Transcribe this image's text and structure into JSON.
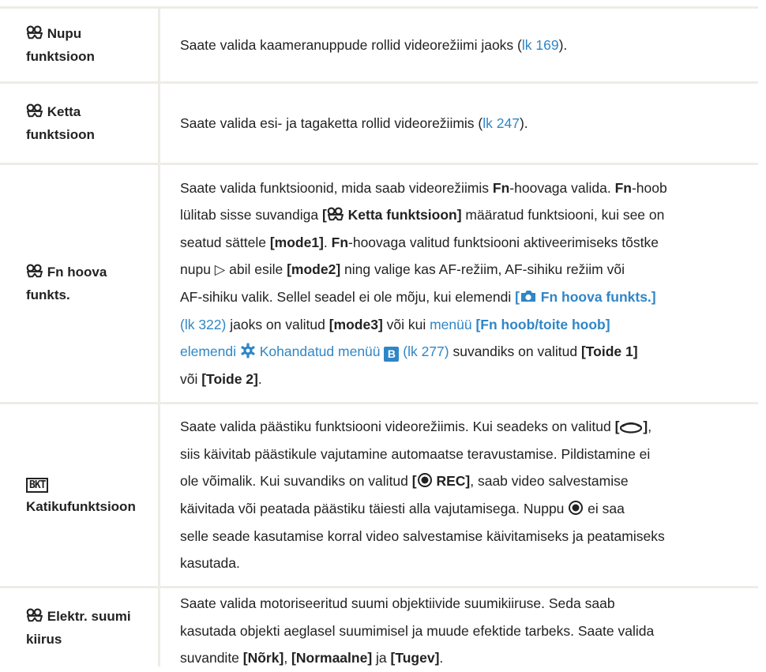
{
  "rows": [
    {
      "label_line1": "Nupu",
      "label_line2": "funktsioon",
      "desc_pre": "Saate valida kaameranuppude rollid videorežiimi jaoks (",
      "desc_link": "lk 169",
      "desc_post": ")."
    },
    {
      "label_line1": "Ketta",
      "label_line2": "funktsioon",
      "desc_pre": "Saate valida esi- ja tagaketta rollid videorežiimis (",
      "desc_link": "lk 247",
      "desc_post": ")."
    },
    {
      "label_line1": "Fn hoova",
      "label_line2": "funkts.",
      "t1": "Saate valida funktsioonid, mida saab videorežiimis ",
      "t2": "Fn",
      "t3": "-hoovaga valida. ",
      "t4": "Fn",
      "t5": "-hoob",
      "t6": "lülitab sisse suvandiga ",
      "t7": "[",
      "t8": " Ketta funktsioon]",
      "t9": " määratud funktsiooni, kui see on",
      "t10": "seatud sättele ",
      "t11": "[mode1]",
      "t12": ". ",
      "t13": "Fn",
      "t14": "-hoovaga valitud funktsiooni aktiveerimiseks tõstke",
      "t15": "nupu ",
      "t16": "▷",
      "t17": " abil esile ",
      "t18": "[mode2]",
      "t19": " ning valige kas AF-režiim, AF-sihiku režiim või",
      "t20": "AF-sihiku valik. Sellel seadel ei ole mõju, kui elemendi ",
      "t21": "[",
      "t22": " Fn hoova funkts.]",
      "t23": "(lk 322)",
      "t24": " jaoks on valitud ",
      "t25": "[mode3]",
      "t26": " või kui ",
      "t27": "menüü ",
      "t28": "[Fn hoob/toite hoob]",
      "t29": "elemendi ",
      "t30": " Kohandatud menüü ",
      "t31": "B",
      "t32": " (lk 277)",
      "t33": " suvandiks on valitud ",
      "t34": "[Toide 1]",
      "t35": "või ",
      "t36": "[Toide 2]",
      "t37": "."
    },
    {
      "label_icon_text": "BKT",
      "label_line2": "Katikufunktsioon",
      "l1a": "Saate valida päästiku funktsiooni videorežiimis. Kui seadeks on valitud ",
      "l1b": "[",
      "l1c": "]",
      "l1d": ",",
      "l2": "siis käivitab päästikule vajutamine automaatse teravustamise. Pildistamine ei",
      "l3a": "ole võimalik. Kui suvandiks on valitud ",
      "l3b": "[",
      "l3c": " REC]",
      "l3d": ", saab video salvestamise",
      "l4": "käivitada või peatada päästiku täiesti alla vajutamisega. Nuppu ",
      "l4b": " ei saa",
      "l5": "selle seade kasutamise korral video salvestamise käivitamiseks ja peatamiseks",
      "l6": "kasutada."
    },
    {
      "label_line1": "Elektr. suumi",
      "label_line2": "kiirus",
      "l1": "Saate valida motoriseeritud suumi objektiivide suumikiiruse. Seda saab",
      "l2": "kasutada objekti aeglasel suumimisel ja muude efektide tarbeks. Saate valida",
      "l3a": "suvandite ",
      "l3b": "[Nõrk]",
      "l3c": ", ",
      "l3d": "[Normaalne]",
      "l3e": " ja ",
      "l3f": "[Tugev]",
      "l3g": "."
    }
  ]
}
